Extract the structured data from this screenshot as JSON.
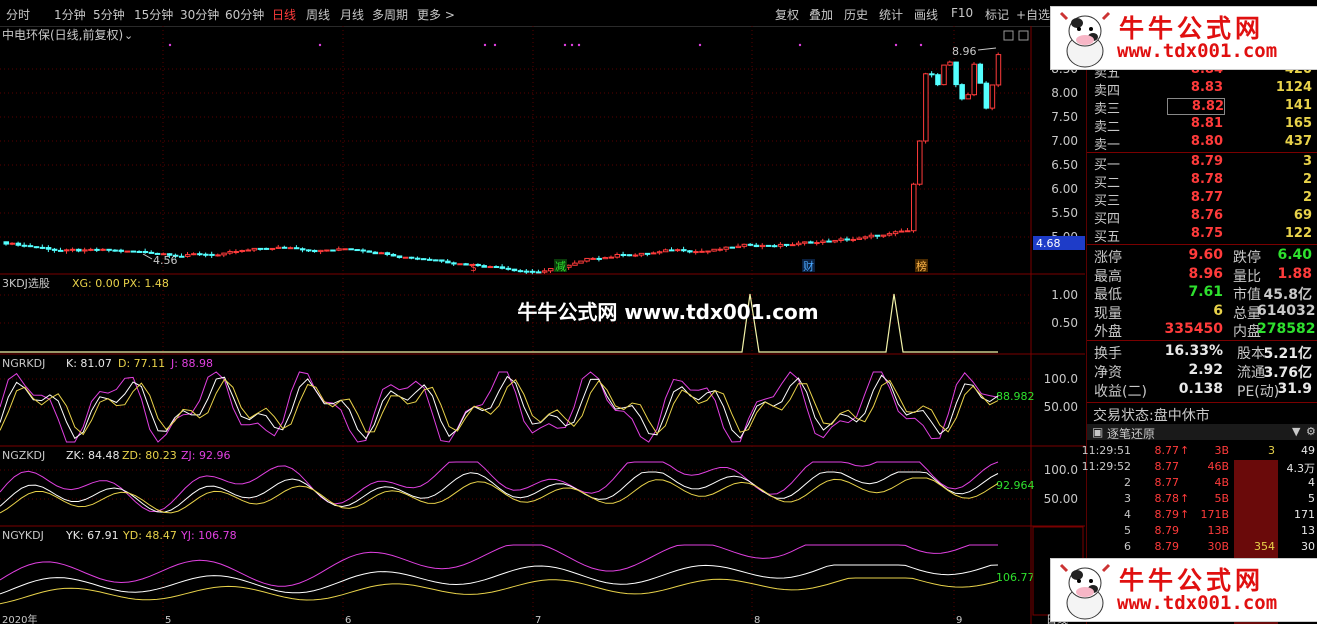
{
  "toolbar": {
    "left": [
      "分时",
      "1分钟",
      "5分钟",
      "15分钟",
      "30分钟",
      "60分钟",
      "日线",
      "周线",
      "月线",
      "多周期",
      "更多 >"
    ],
    "active": "日线",
    "right": [
      "复权",
      "叠加",
      "历史",
      "统计",
      "画线",
      "F10",
      "标记",
      "+自选"
    ]
  },
  "stock_title": "中电环保(日线,前复权)",
  "price_axis": [
    "8.50",
    "8.00",
    "7.50",
    "7.00",
    "6.50",
    "6.00",
    "5.50",
    "5.00"
  ],
  "current_price_badge": "4.68",
  "high_label": "8.96",
  "low_label": "4.56",
  "markers": [
    "$",
    "减",
    "财",
    "榜"
  ],
  "watermark_center": "牛牛公式网 www.tdx001.com",
  "logo": {
    "line1": "牛牛公式网",
    "line2": "www.tdx001.com"
  },
  "panels": {
    "p1": {
      "name": "3KDJ选股",
      "items": [
        "XG: 0.00",
        "PX: 1.48"
      ],
      "axis": [
        "1.00",
        "0.50"
      ]
    },
    "p2": {
      "name": "NGRKDJ",
      "items": [
        "K: 81.07",
        "D: 77.11",
        "J: 88.98"
      ],
      "axis": [
        "100.0",
        "50.00"
      ],
      "last": "88.982"
    },
    "p3": {
      "name": "NGZKDJ",
      "items": [
        "ZK: 84.48",
        "ZD: 80.23",
        "ZJ: 92.96"
      ],
      "axis": [
        "100.0",
        "50.00"
      ],
      "last": "92.964"
    },
    "p4": {
      "name": "NGYKDJ",
      "items": [
        "YK: 67.91",
        "YD: 48.47",
        "YJ: 106.78"
      ],
      "last": "106.77"
    }
  },
  "date_axis": [
    "2020年",
    "5",
    "6",
    "7",
    "8",
    "9"
  ],
  "quote": {
    "asks": [
      {
        "label": "卖五",
        "price": "8.84",
        "vol": "420"
      },
      {
        "label": "卖四",
        "price": "8.83",
        "vol": "1124"
      },
      {
        "label": "卖三",
        "price": "8.82",
        "vol": "141"
      },
      {
        "label": "卖二",
        "price": "8.81",
        "vol": "165"
      },
      {
        "label": "卖一",
        "price": "8.80",
        "vol": "437"
      }
    ],
    "bids": [
      {
        "label": "买一",
        "price": "8.79",
        "vol": "3"
      },
      {
        "label": "买二",
        "price": "8.78",
        "vol": "2"
      },
      {
        "label": "买三",
        "price": "8.77",
        "vol": "2"
      },
      {
        "label": "买四",
        "price": "8.76",
        "vol": "69"
      },
      {
        "label": "买五",
        "price": "8.75",
        "vol": "122"
      }
    ]
  },
  "stats1": [
    {
      "l": "涨停",
      "v": "9.60",
      "c": "#ff3b3b",
      "l2": "跌停",
      "v2": "6.40",
      "c2": "#2ee02e"
    },
    {
      "l": "最高",
      "v": "8.96",
      "c": "#ff3b3b",
      "l2": "量比",
      "v2": "1.88",
      "c2": "#ff3b3b"
    },
    {
      "l": "最低",
      "v": "7.61",
      "c": "#2ee02e",
      "l2": "市值",
      "v2": "45.8亿",
      "c2": "#c8c8c8"
    },
    {
      "l": "现量",
      "v": "6",
      "c": "#e8d24a",
      "l2": "总量",
      "v2": "614032",
      "c2": "#c8c8c8"
    },
    {
      "l": "外盘",
      "v": "335450",
      "c": "#ff3b3b",
      "l2": "内盘",
      "v2": "278582",
      "c2": "#2ee02e"
    }
  ],
  "stats2": [
    {
      "l": "换手",
      "v": "16.33%",
      "l2": "股本",
      "v2": "5.21亿"
    },
    {
      "l": "净资",
      "v": "2.92",
      "l2": "流通",
      "v2": "3.76亿"
    },
    {
      "l": "收益(二)",
      "v": "0.138",
      "l2": "PE(动)",
      "v2": "31.9"
    }
  ],
  "trade_status": "交易状态:盘中休市",
  "tick_header": "逐笔还原",
  "ticks": [
    {
      "t": "11:29:51",
      "p": "8.77",
      "up": true,
      "v": "3B",
      "n": "3",
      "r": "49"
    },
    {
      "t": "11:29:52",
      "p": "8.77",
      "up": false,
      "v": "46B",
      "n": "",
      "r": "4.3万"
    },
    {
      "t": "2",
      "p": "8.77",
      "up": false,
      "v": "4B",
      "n": "",
      "r": "4"
    },
    {
      "t": "3",
      "p": "8.78",
      "up": true,
      "v": "5B",
      "n": "",
      "r": "5"
    },
    {
      "t": "4",
      "p": "8.79",
      "up": true,
      "v": "171B",
      "n": "",
      "r": "171"
    },
    {
      "t": "5",
      "p": "8.79",
      "up": false,
      "v": "13B",
      "n": "",
      "r": "13"
    },
    {
      "t": "6",
      "p": "8.79",
      "up": false,
      "v": "30B",
      "n": "354",
      "r": "30"
    }
  ],
  "week_tab": "日线"
}
